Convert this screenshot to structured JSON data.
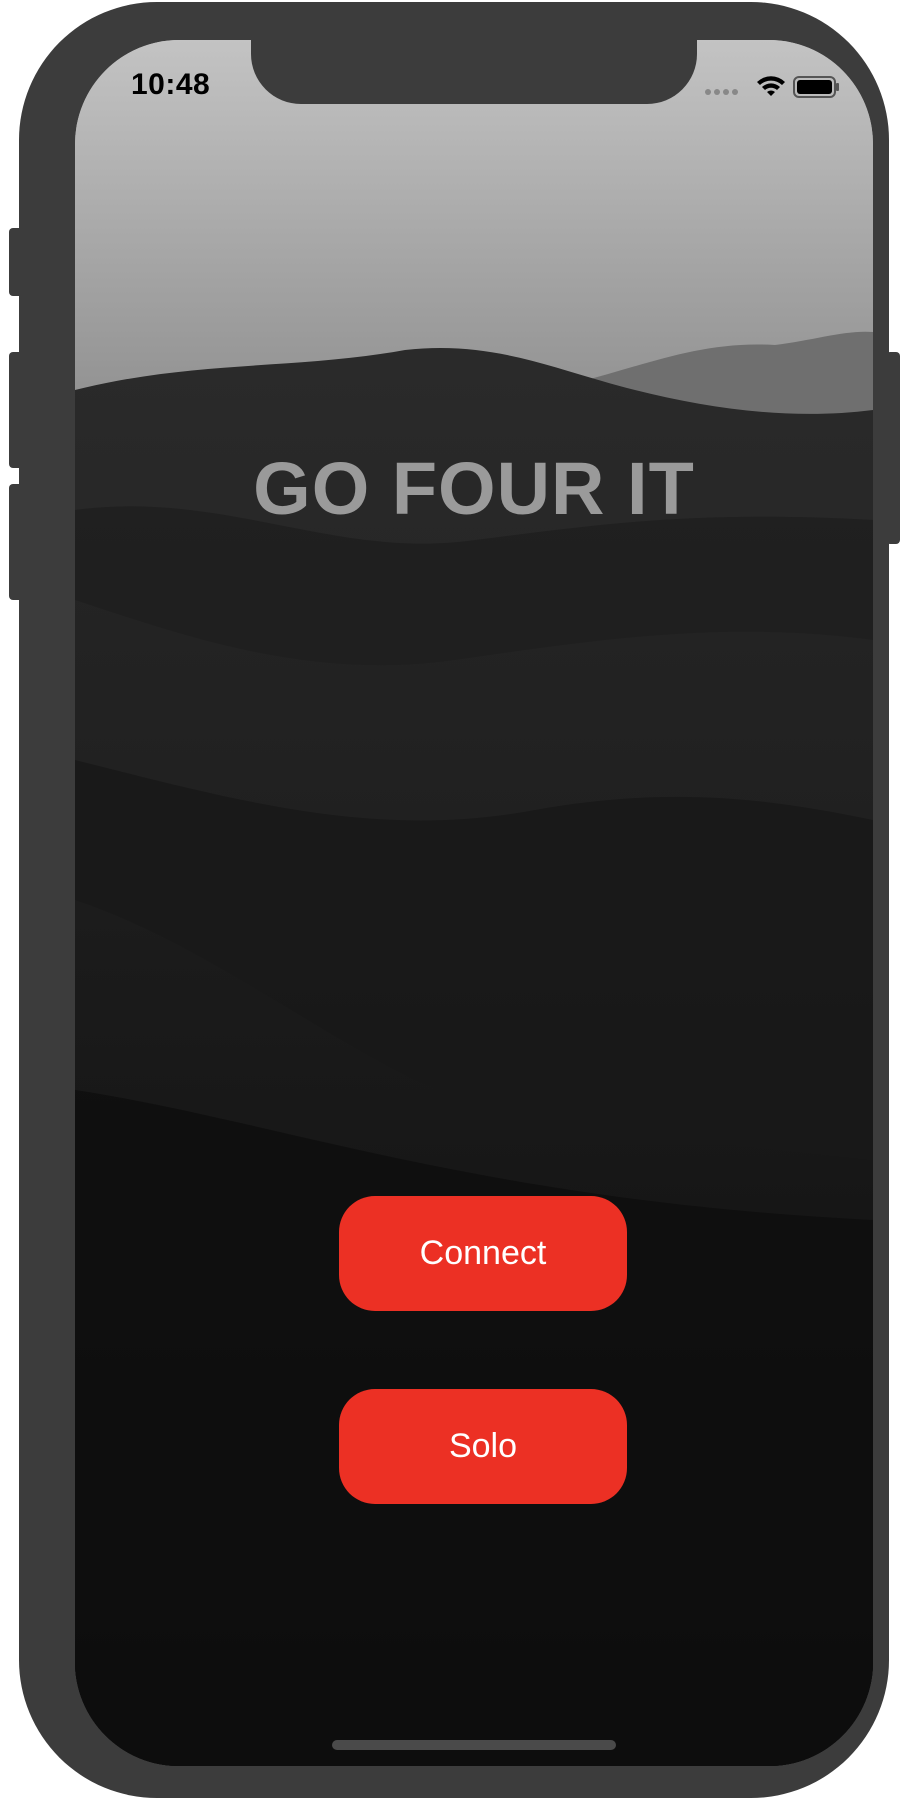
{
  "status_bar": {
    "time": "10:48"
  },
  "app": {
    "title": "GO FOUR IT"
  },
  "buttons": {
    "connect_label": "Connect",
    "solo_label": "Solo"
  },
  "colors": {
    "accent": "#ec3024",
    "title_text": "#9a9a9a",
    "device_frame": "#3c3c3c"
  },
  "icons": {
    "signal": "cellular-signal-icon",
    "wifi": "wifi-icon",
    "battery": "battery-icon"
  }
}
